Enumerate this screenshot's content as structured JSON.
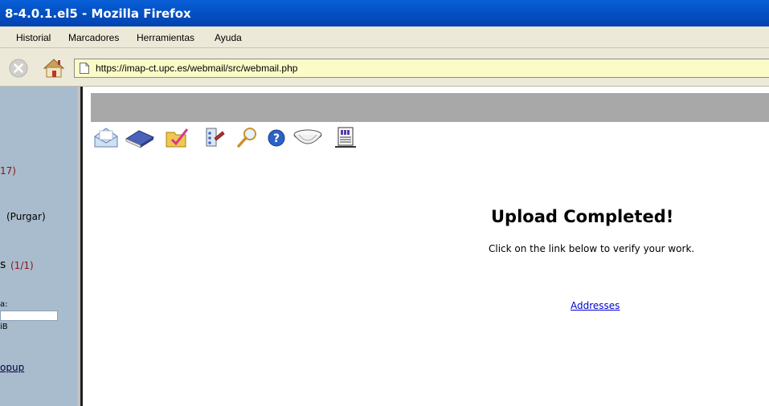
{
  "window": {
    "title": "8-4.0.1.el5 - Mozilla Firefox"
  },
  "menu": {
    "items": [
      "Historial",
      "Marcadores",
      "Herramientas",
      "Ayuda"
    ]
  },
  "nav": {
    "url": "https://imap-ct.upc.es/webmail/src/webmail.php"
  },
  "sidebar": {
    "count_17": "17)",
    "purgar": "(Purgar)",
    "s_letter": "s",
    "count_1_1": "(1/1)",
    "quota_label": "a:",
    "size_unit": "iB",
    "popup_link": "opup"
  },
  "toolbar": {
    "icons": [
      "compose-icon",
      "addressbook-icon",
      "folders-icon",
      "options-icon",
      "search-icon",
      "help-icon",
      "calendar-bowl-icon",
      "notes-icon"
    ]
  },
  "main": {
    "title": "Upload Completed!",
    "message": "Click on the link below to verify your work.",
    "link": "Addresses"
  },
  "colors": {
    "titlebar": "#0453c7",
    "chrome": "#ece9d8",
    "urlbar": "#fbfbc8",
    "sidebar": "#a9bccd",
    "accent_red": "#8a1414",
    "link": "#0000cc"
  }
}
